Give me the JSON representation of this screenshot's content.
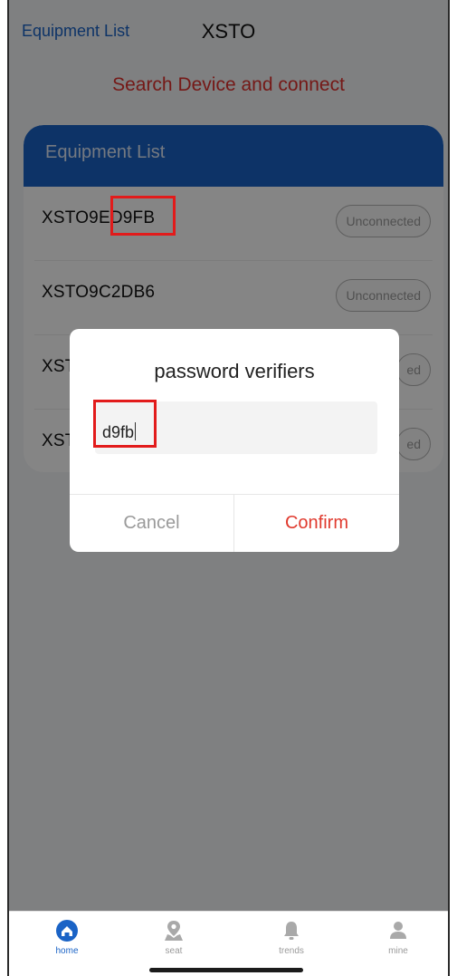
{
  "header": {
    "back_label": "Equipment List",
    "title": "XSTO"
  },
  "subtitle": "Search Device and connect",
  "equipment_list": {
    "heading": "Equipment List",
    "items": [
      {
        "name": "XSTO9ED9FB",
        "status": "Unconnected"
      },
      {
        "name": "XSTO9C2DB6",
        "status": "Unconnected"
      },
      {
        "name": "XST",
        "status": "ed"
      },
      {
        "name": "XST",
        "status": "ed"
      }
    ]
  },
  "dialog": {
    "title": "password verifiers",
    "password_value": "d9fb",
    "cancel_label": "Cancel",
    "confirm_label": "Confirm"
  },
  "tabbar": {
    "items": [
      {
        "label": "home",
        "icon": "home-icon",
        "active": true
      },
      {
        "label": "seat",
        "icon": "map-pin-icon",
        "active": false
      },
      {
        "label": "trends",
        "icon": "bell-icon",
        "active": false
      },
      {
        "label": "mine",
        "icon": "user-icon",
        "active": false
      }
    ]
  },
  "colors": {
    "accent": "#1a63c6",
    "danger": "#e03a2e",
    "highlight": "#e21b1b"
  }
}
